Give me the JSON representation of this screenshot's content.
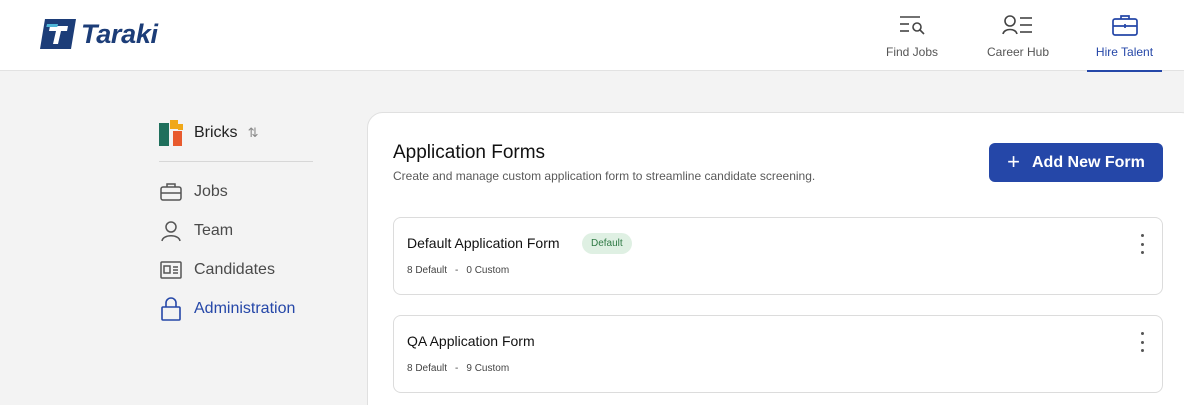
{
  "brand": {
    "name": "Taraki"
  },
  "nav": [
    {
      "label": "Find Jobs",
      "icon": "search-list-icon",
      "active": false
    },
    {
      "label": "Career Hub",
      "icon": "person-list-icon",
      "active": false
    },
    {
      "label": "Hire Talent",
      "icon": "briefcase-icon",
      "active": true
    }
  ],
  "sidebar": {
    "org": {
      "name": "Bricks",
      "sort_glyph": "⇅"
    },
    "items": [
      {
        "label": "Jobs",
        "icon": "briefcase-icon",
        "active": false
      },
      {
        "label": "Team",
        "icon": "user-icon",
        "active": false
      },
      {
        "label": "Candidates",
        "icon": "id-card-icon",
        "active": false
      },
      {
        "label": "Administration",
        "icon": "lock-icon",
        "active": true
      }
    ]
  },
  "main": {
    "title": "Application Forms",
    "subtitle": "Create and manage custom application form to streamline candidate screening.",
    "add_button": {
      "plus": "+",
      "label": "Add New Form"
    },
    "forms": [
      {
        "title": "Default Application Form",
        "badge": "Default",
        "default_count": "8 Default",
        "separator": "-",
        "custom_count": "0 Custom"
      },
      {
        "title": "QA Application Form",
        "badge": "",
        "default_count": "8 Default",
        "separator": "-",
        "custom_count": "9 Custom"
      }
    ]
  },
  "colors": {
    "primary": "#2547a8",
    "brand_dark": "#1c3d78",
    "badge_bg": "#dff0e3",
    "badge_text": "#2f7a45"
  }
}
